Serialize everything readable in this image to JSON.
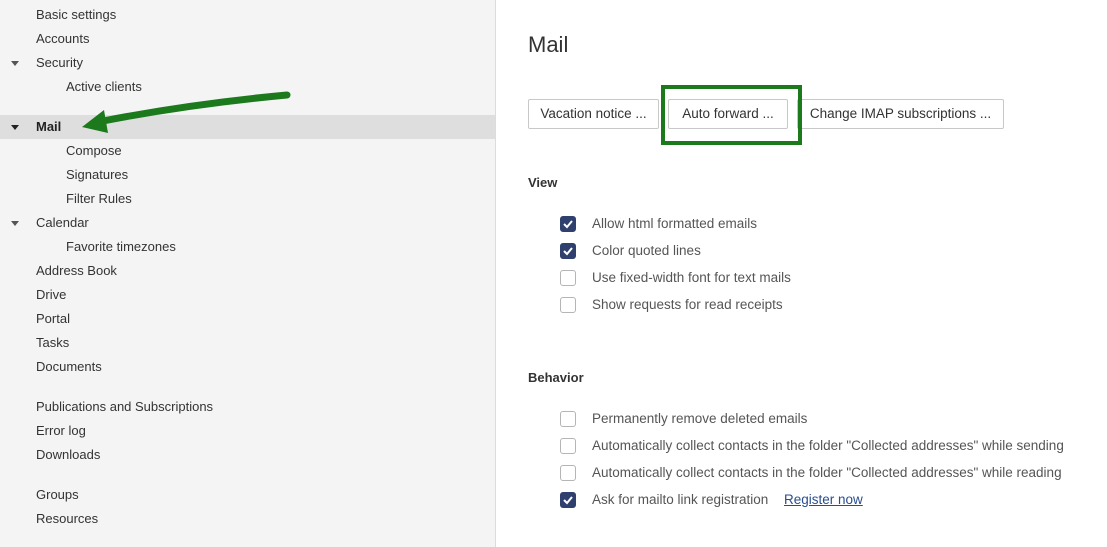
{
  "sidebar": {
    "items": [
      {
        "label": "Basic settings"
      },
      {
        "label": "Accounts"
      },
      {
        "label": "Security"
      },
      {
        "label": "Active clients"
      },
      {
        "label": "Mail"
      },
      {
        "label": "Compose"
      },
      {
        "label": "Signatures"
      },
      {
        "label": "Filter Rules"
      },
      {
        "label": "Calendar"
      },
      {
        "label": "Favorite timezones"
      },
      {
        "label": "Address Book"
      },
      {
        "label": "Drive"
      },
      {
        "label": "Portal"
      },
      {
        "label": "Tasks"
      },
      {
        "label": "Documents"
      },
      {
        "label": "Publications and Subscriptions"
      },
      {
        "label": "Error log"
      },
      {
        "label": "Downloads"
      },
      {
        "label": "Groups"
      },
      {
        "label": "Resources"
      }
    ],
    "selected": "Mail"
  },
  "main": {
    "title": "Mail",
    "buttons": {
      "vacation": "Vacation notice ...",
      "auto_forward": "Auto forward ...",
      "imap": "Change IMAP subscriptions ..."
    },
    "view": {
      "title": "View",
      "options": [
        {
          "label": "Allow html formatted emails",
          "checked": true
        },
        {
          "label": "Color quoted lines",
          "checked": true
        },
        {
          "label": "Use fixed-width font for text mails",
          "checked": false
        },
        {
          "label": "Show requests for read receipts",
          "checked": false
        }
      ]
    },
    "behavior": {
      "title": "Behavior",
      "options": [
        {
          "label": "Permanently remove deleted emails",
          "checked": false
        },
        {
          "label": "Automatically collect contacts in the folder \"Collected addresses\" while sending",
          "checked": false
        },
        {
          "label": "Automatically collect contacts in the folder \"Collected addresses\" while reading",
          "checked": false
        },
        {
          "label": "Ask for mailto link registration",
          "checked": true
        }
      ],
      "register_link": "Register now"
    }
  },
  "colors": {
    "checkbox_checked": "#2f3f6e",
    "annotation_green": "#1c7a1c",
    "selected_row": "#dedede",
    "link": "#2a4d8f"
  }
}
